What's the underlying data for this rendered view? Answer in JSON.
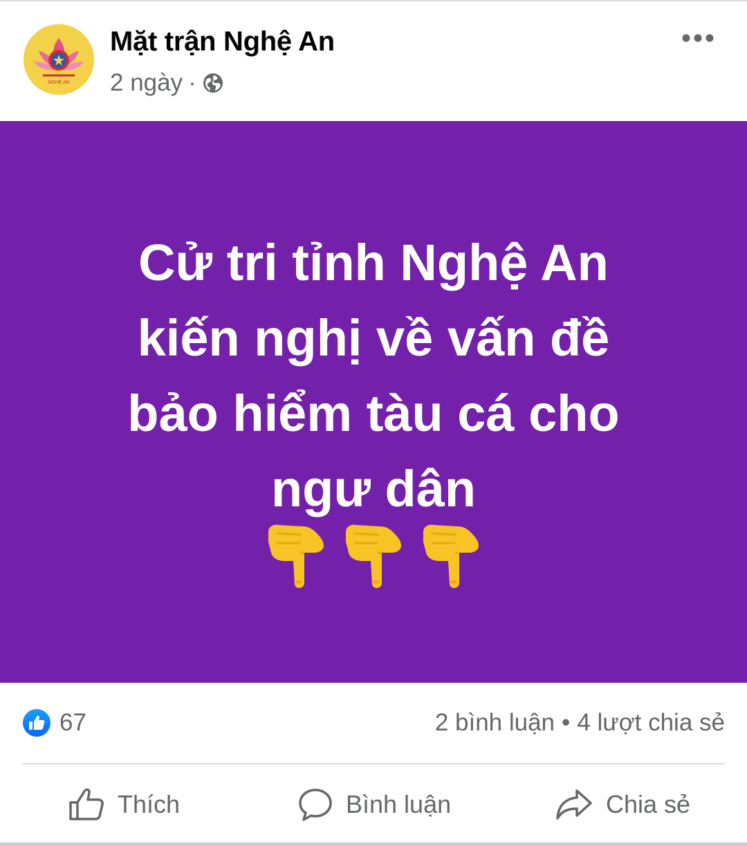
{
  "post": {
    "page_name": "Mặt trận Nghệ An",
    "time": "2 ngày",
    "separator": "·",
    "audience_icon": "globe-icon",
    "menu_icon": "more-horizontal-icon"
  },
  "banner": {
    "background": "#7321ab",
    "text_color": "#ffffff",
    "lines": [
      "Cử tri tỉnh Nghệ An",
      "kiến nghị về vấn đề",
      "bảo hiểm tàu cá cho",
      "ngư dân"
    ],
    "emoji_icon": "backhand-index-pointing-down-icon",
    "emoji_count": 3
  },
  "stats": {
    "reaction_icon": "like-reaction-icon",
    "likes": "67",
    "comments": "2 bình luận",
    "bullet": "•",
    "shares": "4 lượt chia sẻ"
  },
  "actions": {
    "like_label": "Thích",
    "comment_label": "Bình luận",
    "share_label": "Chia sẻ"
  },
  "colors": {
    "accent_blue": "#1877f2",
    "secondary_text": "#65676b",
    "primary_text": "#050505"
  }
}
